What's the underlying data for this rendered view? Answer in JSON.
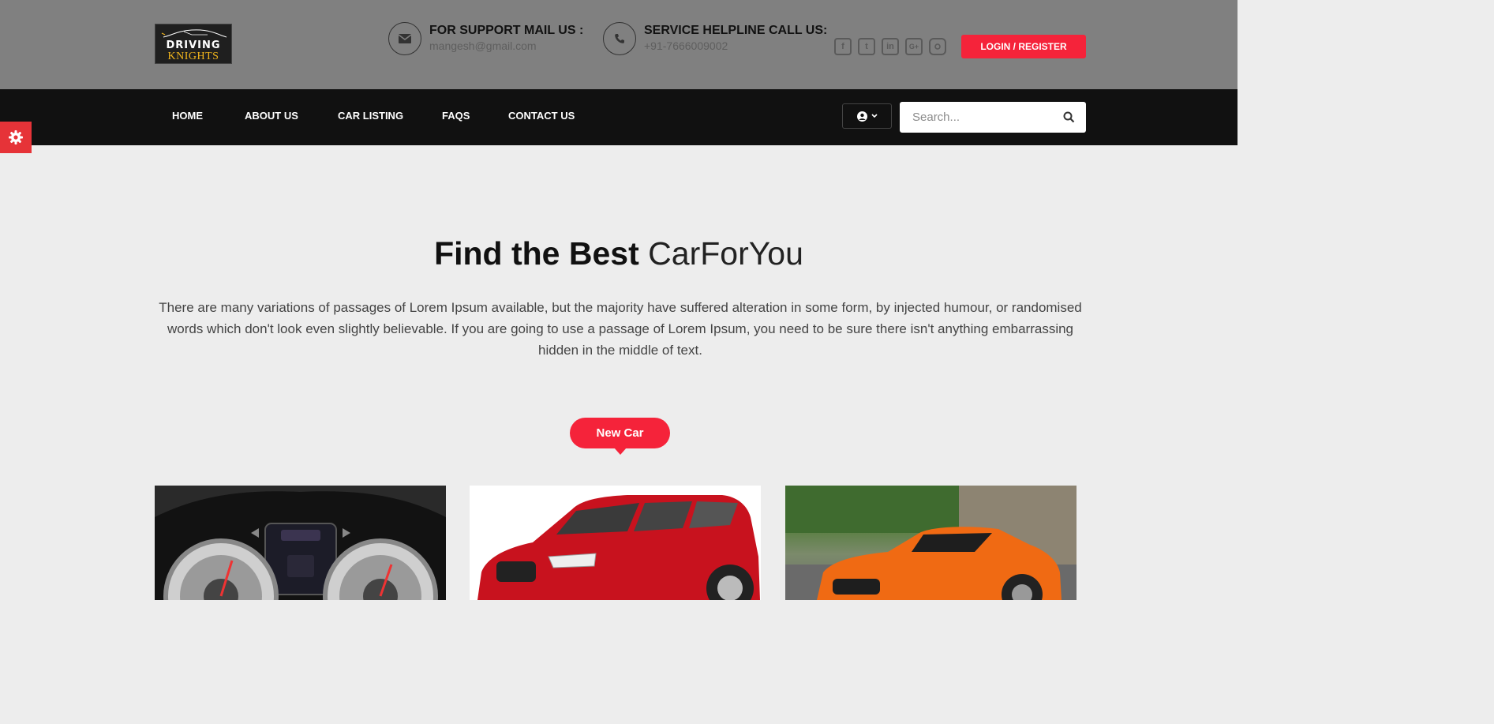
{
  "header": {
    "logo": {
      "line1": "DRIVING",
      "line2": "KNIGHTS"
    },
    "support": {
      "title": "FOR SUPPORT MAIL US :",
      "value": "mangesh@gmail.com",
      "icon": "envelope-icon"
    },
    "helpline": {
      "title": "SERVICE HELPLINE CALL US:",
      "value": "+91-7666009002",
      "icon": "phone-icon"
    },
    "social": [
      "facebook-icon",
      "twitter-icon",
      "linkedin-icon",
      "google-plus-icon",
      "instagram-icon"
    ],
    "login_label": "LOGIN / REGISTER"
  },
  "nav": {
    "items": [
      "HOME",
      "ABOUT US",
      "CAR LISTING",
      "FAQS",
      "CONTACT US"
    ],
    "search_placeholder": "Search..."
  },
  "main": {
    "heading_bold": "Find the Best",
    "heading_light": "CarForYou",
    "description": "There are many variations of passages of Lorem Ipsum available, but the majority have suffered alteration in some form, by injected humour, or randomised words which don't look even slightly believable. If you are going to use a passage of Lorem Ipsum, you need to be sure there isn't anything embarrassing hidden in the middle of text.",
    "tab_label": "New Car"
  },
  "colors": {
    "accent": "#f5233a",
    "topbar": "#808080",
    "navbar": "#111111",
    "page_bg": "#ededed"
  }
}
